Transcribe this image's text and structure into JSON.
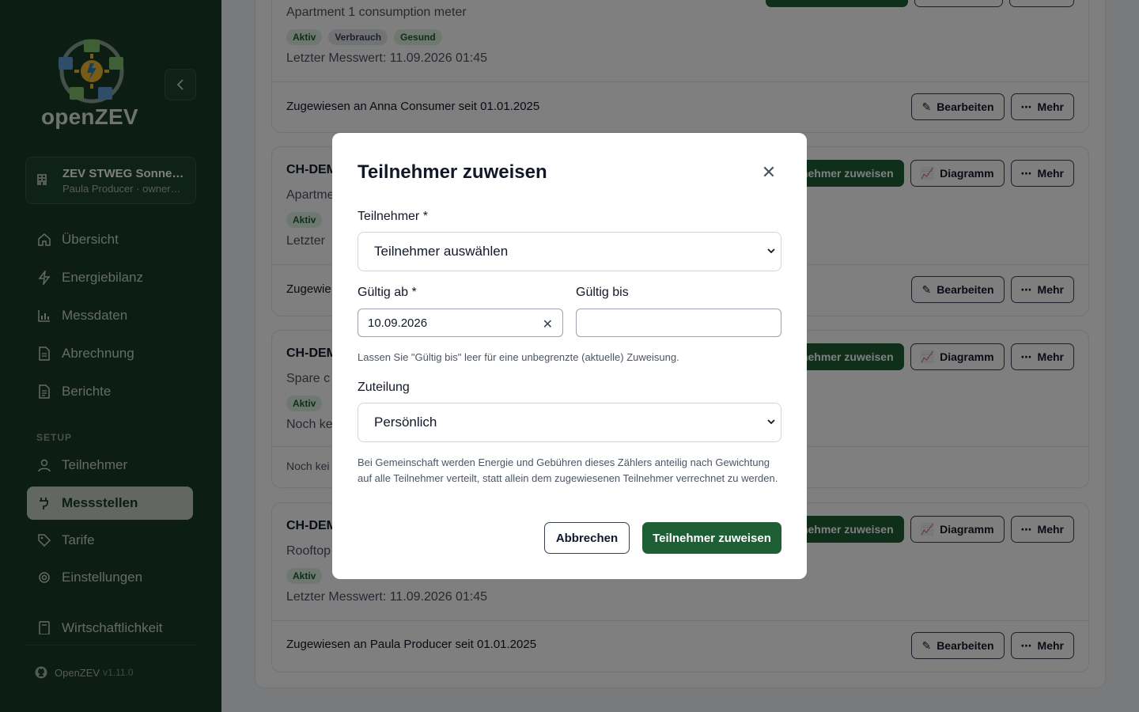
{
  "sidebar": {
    "brand": "openZEV",
    "org": {
      "name": "ZEV STWEG Sonne…",
      "sub": "Paula Producer · owner…"
    },
    "nav": [
      {
        "label": "Übersicht",
        "icon": "home-icon"
      },
      {
        "label": "Energiebilanz",
        "icon": "bolt-icon"
      },
      {
        "label": "Messdaten",
        "icon": "bar-chart-icon"
      },
      {
        "label": "Abrechnung",
        "icon": "document-icon"
      },
      {
        "label": "Berichte",
        "icon": "report-icon"
      }
    ],
    "setup_label": "SETUP",
    "setup_nav": [
      {
        "label": "Teilnehmer",
        "icon": "user-icon"
      },
      {
        "label": "Messstellen",
        "icon": "plug-icon",
        "active": true
      },
      {
        "label": "Tarife",
        "icon": "tag-icon"
      },
      {
        "label": "Einstellungen",
        "icon": "settings-icon"
      },
      {
        "label": "Wirtschaftlichkeit",
        "icon": "calculator-icon"
      }
    ],
    "footer": {
      "name": "OpenZEV",
      "version": "v1.11.0"
    }
  },
  "cards": [
    {
      "desc": "Apartment 1 consumption meter",
      "badges": [
        "Aktiv",
        "Verbrauch",
        "Gesund"
      ],
      "meta": "Letzter Messwert: 11.09.2026 01:45",
      "foot": "Zugewiesen an Anna Consumer seit 01.01.2025",
      "actions": [
        "Bearbeiten",
        "Mehr"
      ]
    },
    {
      "title": "CH-DEM",
      "desc": "Apartme",
      "badges": [
        "Aktiv"
      ],
      "meta": "Letzter",
      "foot": "Zugewie",
      "top_actions": [
        "Teilnehmer zuweisen",
        "Diagramm",
        "Mehr"
      ],
      "actions": [
        "Bearbeiten",
        "Mehr"
      ]
    },
    {
      "title": "CH-DEM",
      "desc": "Spare c",
      "badges": [
        "Aktiv"
      ],
      "meta": "Noch ke",
      "foot": "Noch kei",
      "top_actions": [
        "Teilnehmer zuweisen",
        "Diagramm",
        "Mehr"
      ]
    },
    {
      "title": "CH-DEM",
      "desc": "Rooftop",
      "badges": [
        "Aktiv"
      ],
      "meta": "Letzter Messwert: 11.09.2026 01:45",
      "foot": "Zugewiesen an Paula Producer seit 01.01.2025",
      "top_actions": [
        "Teilnehmer zuweisen",
        "Diagramm",
        "Mehr"
      ],
      "actions": [
        "Bearbeiten",
        "Mehr"
      ]
    }
  ],
  "modal": {
    "title": "Teilnehmer zuweisen",
    "participant_label": "Teilnehmer *",
    "participant_value": "Teilnehmer auswählen",
    "valid_from_label": "Gültig ab *",
    "valid_from_value": "10.09.2026",
    "valid_to_label": "Gültig bis",
    "valid_to_value": "",
    "valid_help": "Lassen Sie \"Gültig bis\" leer für eine unbegrenzte (aktuelle) Zuweisung.",
    "allocation_label": "Zuteilung",
    "allocation_value": "Persönlich",
    "allocation_help": "Bei Gemeinschaft werden Energie und Gebühren dieses Zählers anteilig nach Gewichtung auf alle Teilnehmer verteilt, statt allein dem zugewiesenen Teilnehmer verrechnet zu werden.",
    "cancel_label": "Abbrechen",
    "submit_label": "Teilnehmer zuweisen"
  },
  "colors": {
    "sidebar": "#183b28",
    "accent": "#1f5f36",
    "active_nav": "#c4cfc7"
  }
}
